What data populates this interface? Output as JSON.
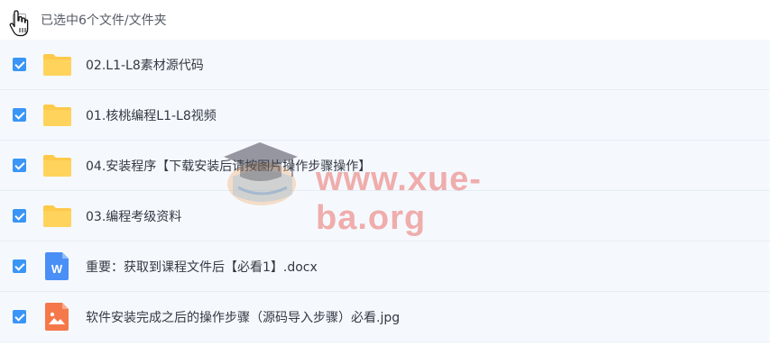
{
  "header": {
    "selection_label": "已选中6个文件/文件夹"
  },
  "files": [
    {
      "name": "02.L1-L8素材源代码",
      "type": "folder"
    },
    {
      "name": "01.核桃编程L1-L8视频",
      "type": "folder"
    },
    {
      "name": "04.安装程序【下载安装后请按图片操作步骤操作】",
      "type": "folder"
    },
    {
      "name": "03.编程考级资料",
      "type": "folder"
    },
    {
      "name": "重要：获取到课程文件后【必看1】.docx",
      "type": "word-document"
    },
    {
      "name": "软件安装完成之后的操作步骤（源码导入步骤）必看.jpg",
      "type": "image"
    }
  ],
  "watermark": {
    "text": "www.xue-ba.org"
  },
  "colors": {
    "accent": "#3a95f7",
    "folder": "#ffc94a",
    "word": "#4a8ff5",
    "image": "#f5784a",
    "row_bg": "#f5f9fe"
  }
}
